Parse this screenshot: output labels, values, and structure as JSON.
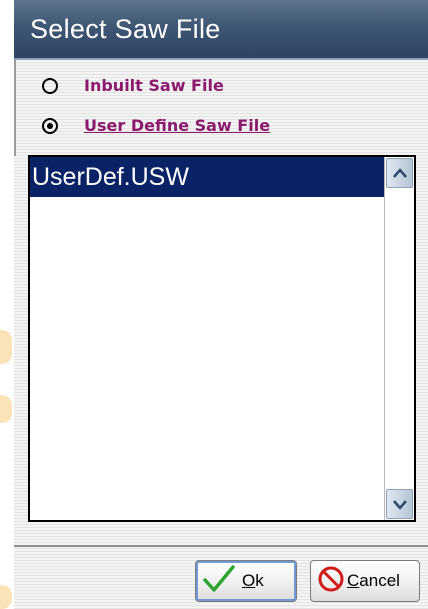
{
  "dialog": {
    "title": "Select Saw File"
  },
  "options": {
    "inbuilt_label": "Inbuilt Saw File",
    "inbuilt_selected": false,
    "user_label": "User Define Saw File",
    "user_selected": true,
    "label_color": "#8b1a6c"
  },
  "file_list": {
    "items": [
      "UserDef.USW"
    ],
    "selected_index": 0,
    "selection_color": "#0a2366"
  },
  "buttons": {
    "ok": {
      "mnemonic": "O",
      "rest": "k",
      "icon": "checkmark-icon"
    },
    "cancel": {
      "mnemonic": "C",
      "rest": "ancel",
      "icon": "no-entry-icon"
    }
  },
  "colors": {
    "titlebar": "#3f5674",
    "title_text": "#ffffff"
  }
}
